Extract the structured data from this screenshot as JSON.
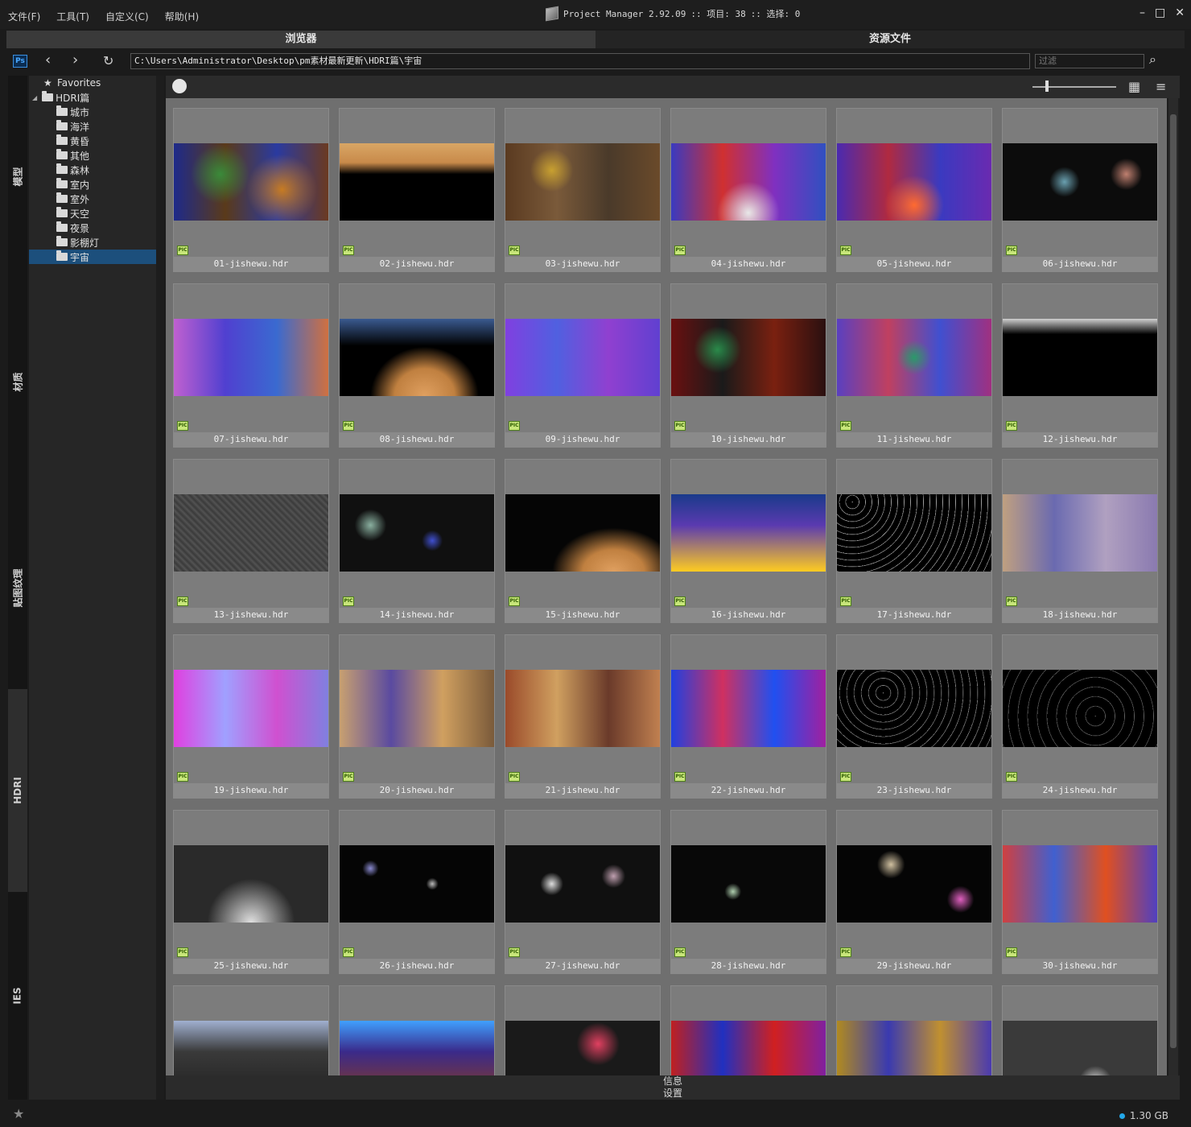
{
  "menu": [
    "文件(F)",
    "工具(T)",
    "自定义(C)",
    "帮助(H)"
  ],
  "title": {
    "app_name": "Project Manager 2.92.09",
    "items_label": ":: 项目: 38",
    "selected_label": ":: 选择: 0"
  },
  "window_buttons": [
    "–",
    "□",
    "✕"
  ],
  "tabs": [
    "浏览器",
    "资源文件"
  ],
  "address": {
    "ps_label": "Ps",
    "path": "C:\\Users\\Administrator\\Desktop\\pm素材最新更新\\HDRI篇\\宇宙",
    "filter_placeholder": "过滤"
  },
  "side_tabs": [
    "模型",
    "材质",
    "贴图纹理",
    "HDRI",
    "IES"
  ],
  "tree": {
    "favorites": "Favorites",
    "root": "HDRI篇",
    "children": [
      "城市",
      "海洋",
      "黄昏",
      "其他",
      "森林",
      "室内",
      "室外",
      "天空",
      "夜景",
      "影棚灯",
      "宇宙"
    ],
    "selected": "宇宙"
  },
  "badge_label": "PIC",
  "files": [
    "01-jishewu.hdr",
    "02-jishewu.hdr",
    "03-jishewu.hdr",
    "04-jishewu.hdr",
    "05-jishewu.hdr",
    "06-jishewu.hdr",
    "07-jishewu.hdr",
    "08-jishewu.hdr",
    "09-jishewu.hdr",
    "10-jishewu.hdr",
    "11-jishewu.hdr",
    "12-jishewu.hdr",
    "13-jishewu.hdr",
    "14-jishewu.hdr",
    "15-jishewu.hdr",
    "16-jishewu.hdr",
    "17-jishewu.hdr",
    "18-jishewu.hdr",
    "19-jishewu.hdr",
    "20-jishewu.hdr",
    "21-jishewu.hdr",
    "22-jishewu.hdr",
    "23-jishewu.hdr",
    "24-jishewu.hdr",
    "25-jishewu.hdr",
    "26-jishewu.hdr",
    "27-jishewu.hdr",
    "28-jishewu.hdr",
    "29-jishewu.hdr",
    "30-jishewu.hdr",
    "",
    "",
    "",
    "",
    "",
    ""
  ],
  "bottom_panels": [
    "信息",
    "设置"
  ],
  "status": {
    "disk_usage": "1.30 GB",
    "indicator_color": "#23a7e8"
  },
  "colors": {
    "selection": "#1c4f7c",
    "grid_background": "#6f6f6f",
    "badge": "#c8e67a"
  },
  "icons": {
    "refresh": "refresh-icon",
    "search": "search-icon",
    "grid_view": "grid-view-icon",
    "sort": "sort-icon",
    "favorites": "star-icon",
    "folder": "folder-icon"
  }
}
